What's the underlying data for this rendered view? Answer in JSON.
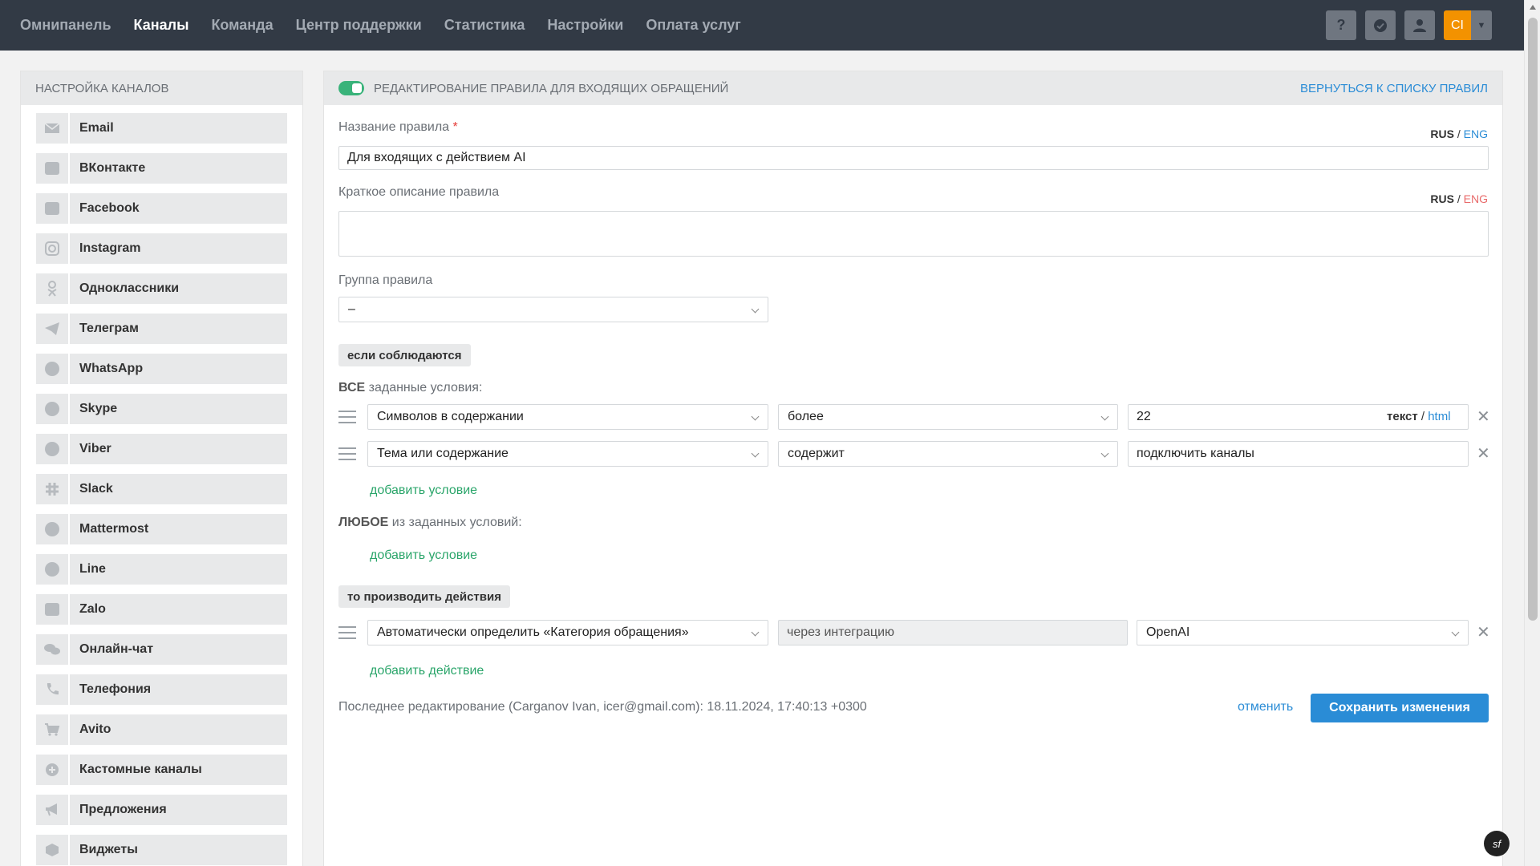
{
  "nav": {
    "items": [
      "Омнипанель",
      "Каналы",
      "Команда",
      "Центр поддержки",
      "Статистика",
      "Настройки",
      "Оплата услуг"
    ],
    "active_index": 1
  },
  "top_actions": {
    "help_label": "?",
    "user_initials": "CI"
  },
  "sidebar": {
    "title": "Настройка каналов",
    "channels": [
      {
        "label": "Email",
        "icon": "envelope-icon"
      },
      {
        "label": "ВКонтакте",
        "icon": "vk-icon"
      },
      {
        "label": "Facebook",
        "icon": "facebook-icon"
      },
      {
        "label": "Instagram",
        "icon": "instagram-icon"
      },
      {
        "label": "Одноклассники",
        "icon": "odnoklassniki-icon"
      },
      {
        "label": "Телеграм",
        "icon": "telegram-icon"
      },
      {
        "label": "WhatsApp",
        "icon": "whatsapp-icon"
      },
      {
        "label": "Skype",
        "icon": "skype-icon"
      },
      {
        "label": "Viber",
        "icon": "viber-icon"
      },
      {
        "label": "Slack",
        "icon": "slack-icon"
      },
      {
        "label": "Mattermost",
        "icon": "mattermost-icon"
      },
      {
        "label": "Line",
        "icon": "line-icon"
      },
      {
        "label": "Zalo",
        "icon": "zalo-icon"
      },
      {
        "label": "Онлайн-чат",
        "icon": "chat-icon"
      },
      {
        "label": "Телефония",
        "icon": "phone-icon"
      },
      {
        "label": "Avito",
        "icon": "cart-icon"
      },
      {
        "label": "Кастомные каналы",
        "icon": "plus-circle-icon"
      },
      {
        "label": "Предложения",
        "icon": "megaphone-icon"
      },
      {
        "label": "Виджеты",
        "icon": "box-icon"
      }
    ]
  },
  "panel": {
    "title": "Редактирование правила для входящих обращений",
    "back_link": "Вернуться к списку правил",
    "rule_name_label": "Название правила",
    "required_mark": "*",
    "lang_rus": "RUS",
    "lang_sep": "/",
    "lang_eng": "ENG",
    "rule_name_value": "Для входящих с действием AI",
    "description_label": "Краткое описание правила",
    "description_value": "",
    "group_label": "Группа правила",
    "group_value": "–",
    "if_chip": "если соблюдаются",
    "all_prefix": "ВСЕ",
    "all_suffix": "заданные условия:",
    "conditions": [
      {
        "field": "Символов в содержании",
        "operator": "более",
        "value": "22"
      },
      {
        "field": "Тема или содержание",
        "operator": "содержит",
        "value": "подключить каналы"
      }
    ],
    "text_label": "текст",
    "html_label": "html",
    "add_condition": "добавить условие",
    "any_prefix": "ЛЮБОЕ",
    "any_suffix": "из заданных условий:",
    "then_chip": "то производить действия",
    "action": {
      "what": "Автоматически определить «Категория обращения»",
      "how": "через интеграцию",
      "integration": "OpenAI"
    },
    "add_action": "добавить действие",
    "last_edit": "Последнее редактирование (Carganov Ivan, icer@gmail.com): 18.11.2024, 17:40:13 +0300",
    "cancel": "отменить",
    "save": "Сохранить изменения"
  },
  "colors": {
    "topbar": "#323a45",
    "accent_blue": "#2a8cd6",
    "accent_green": "#2aa56a",
    "user_orange": "#f39200"
  }
}
